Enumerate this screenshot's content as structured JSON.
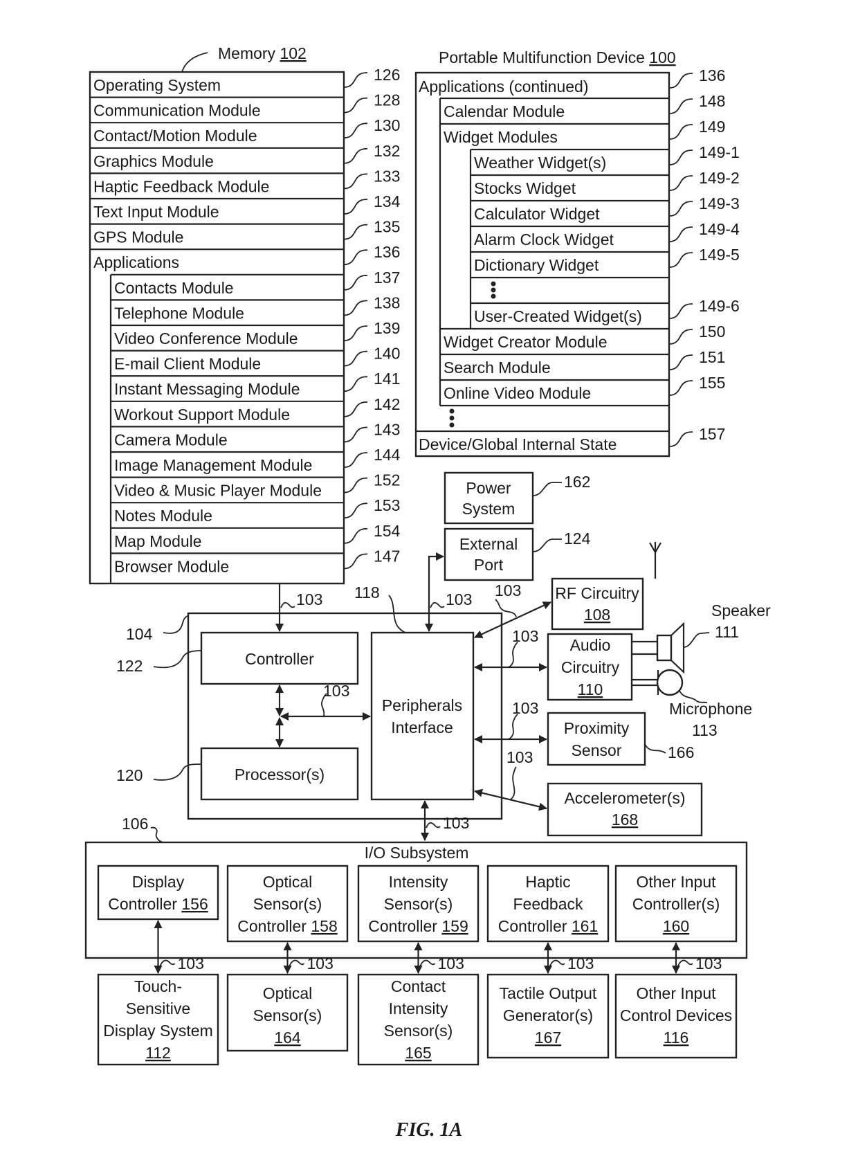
{
  "figure_label": "FIG. 1A",
  "memory": {
    "title": "Memory",
    "ref": "102",
    "rows": [
      {
        "label": "Operating System",
        "ref": "126"
      },
      {
        "label": "Communication Module",
        "ref": "128"
      },
      {
        "label": "Contact/Motion Module",
        "ref": "130"
      },
      {
        "label": "Graphics Module",
        "ref": "132"
      },
      {
        "label": "Haptic Feedback Module",
        "ref": "133"
      },
      {
        "label": "Text Input Module",
        "ref": "134"
      },
      {
        "label": "GPS Module",
        "ref": "135"
      },
      {
        "label": "Applications",
        "ref": "136"
      }
    ],
    "applications": [
      {
        "label": "Contacts Module",
        "ref": "137"
      },
      {
        "label": "Telephone Module",
        "ref": "138"
      },
      {
        "label": "Video Conference Module",
        "ref": "139"
      },
      {
        "label": "E-mail Client Module",
        "ref": "140"
      },
      {
        "label": "Instant Messaging Module",
        "ref": "141"
      },
      {
        "label": "Workout Support Module",
        "ref": "142"
      },
      {
        "label": "Camera Module",
        "ref": "143"
      },
      {
        "label": "Image Management Module",
        "ref": "144"
      },
      {
        "label": "Video & Music Player Module",
        "ref": "152"
      },
      {
        "label": "Notes Module",
        "ref": "153"
      },
      {
        "label": "Map Module",
        "ref": "154"
      },
      {
        "label": "Browser Module",
        "ref": "147"
      }
    ]
  },
  "device": {
    "title": "Portable Multifunction Device",
    "ref": "100",
    "apps_continued": {
      "label": "Applications (continued)",
      "ref": "136"
    },
    "calendar": {
      "label": "Calendar Module",
      "ref": "148"
    },
    "widget_modules": {
      "label": "Widget Modules",
      "ref": "149"
    },
    "widgets": [
      {
        "label": "Weather Widget(s)",
        "ref": "149-1"
      },
      {
        "label": "Stocks Widget",
        "ref": "149-2"
      },
      {
        "label": "Calculator Widget",
        "ref": "149-3"
      },
      {
        "label": "Alarm Clock Widget",
        "ref": "149-4"
      },
      {
        "label": "Dictionary Widget",
        "ref": "149-5"
      },
      {
        "label": "",
        "ref": ""
      },
      {
        "label": "User-Created Widget(s)",
        "ref": "149-6"
      }
    ],
    "more_modules": [
      {
        "label": "Widget Creator Module",
        "ref": "150"
      },
      {
        "label": "Search Module",
        "ref": "151"
      },
      {
        "label": "Online Video Module",
        "ref": "155"
      }
    ],
    "global_state": {
      "label": "Device/Global Internal State",
      "ref": "157"
    }
  },
  "power_system": {
    "line1": "Power",
    "line2": "System",
    "ref": "162"
  },
  "external_port": {
    "line1": "External",
    "line2": "Port",
    "ref": "124"
  },
  "rf_circuitry": {
    "line1": "RF Circuitry",
    "ref": "108"
  },
  "audio_circuitry": {
    "line1": "Audio",
    "line2": "Circuitry",
    "ref": "110"
  },
  "speaker": {
    "label": "Speaker",
    "ref": "111"
  },
  "microphone": {
    "label": "Microphone",
    "ref": "113"
  },
  "proximity_sensor": {
    "line1": "Proximity",
    "line2": "Sensor",
    "ref": "166"
  },
  "accelerometer": {
    "line1": "Accelerometer(s)",
    "ref": "168"
  },
  "chip": {
    "ref": "104"
  },
  "controller": {
    "label": "Controller",
    "ref": "122"
  },
  "processor": {
    "label": "Processor(s)",
    "ref": "120"
  },
  "peripherals_interface": {
    "line1": "Peripherals",
    "line2": "Interface",
    "ref": "118"
  },
  "bus_ref": "103",
  "io_subsystem": {
    "title": "I/O Subsystem",
    "ref": "106",
    "controllers": [
      {
        "lines": [
          "Display",
          "Controller"
        ],
        "ref": "156"
      },
      {
        "lines": [
          "Optical",
          "Sensor(s)",
          "Controller"
        ],
        "ref": "158"
      },
      {
        "lines": [
          "Intensity",
          "Sensor(s)",
          "Controller"
        ],
        "ref": "159"
      },
      {
        "lines": [
          "Haptic",
          "Feedback",
          "Controller"
        ],
        "ref": "161"
      },
      {
        "lines": [
          "Other Input",
          "Controller(s)"
        ],
        "ref": "160"
      }
    ],
    "devices": [
      {
        "lines": [
          "Touch-",
          "Sensitive",
          "Display System"
        ],
        "ref": "112"
      },
      {
        "lines": [
          "Optical",
          "Sensor(s)"
        ],
        "ref": "164"
      },
      {
        "lines": [
          "Contact",
          "Intensity",
          "Sensor(s)"
        ],
        "ref": "165"
      },
      {
        "lines": [
          "Tactile Output",
          "Generator(s)"
        ],
        "ref": "167"
      },
      {
        "lines": [
          "Other Input",
          "Control Devices"
        ],
        "ref": "116"
      }
    ]
  }
}
